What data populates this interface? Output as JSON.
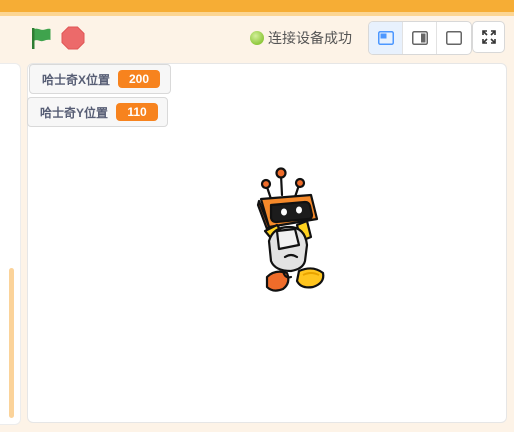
{
  "toolbar": {
    "status_text": "连接设备成功",
    "flag_icon": "green-flag-icon",
    "stop_icon": "stop-icon",
    "modes": [
      "small-stage-mode-icon",
      "side-stage-mode-icon",
      "large-stage-mode-icon"
    ],
    "fullscreen_icon": "fullscreen-icon"
  },
  "stage": {
    "monitors": [
      {
        "label": "哈士奇X位置",
        "value": "200"
      },
      {
        "label": "哈士奇Y位置",
        "value": "110"
      }
    ],
    "sprite_icon": "robot-sprite"
  },
  "colors": {
    "accent": "#f6ad35",
    "monitor_value_bg": "#f7831e",
    "flag_green": "#3fa34d",
    "stop_red": "#ec6a6a",
    "status_green": "#8fc83c"
  }
}
